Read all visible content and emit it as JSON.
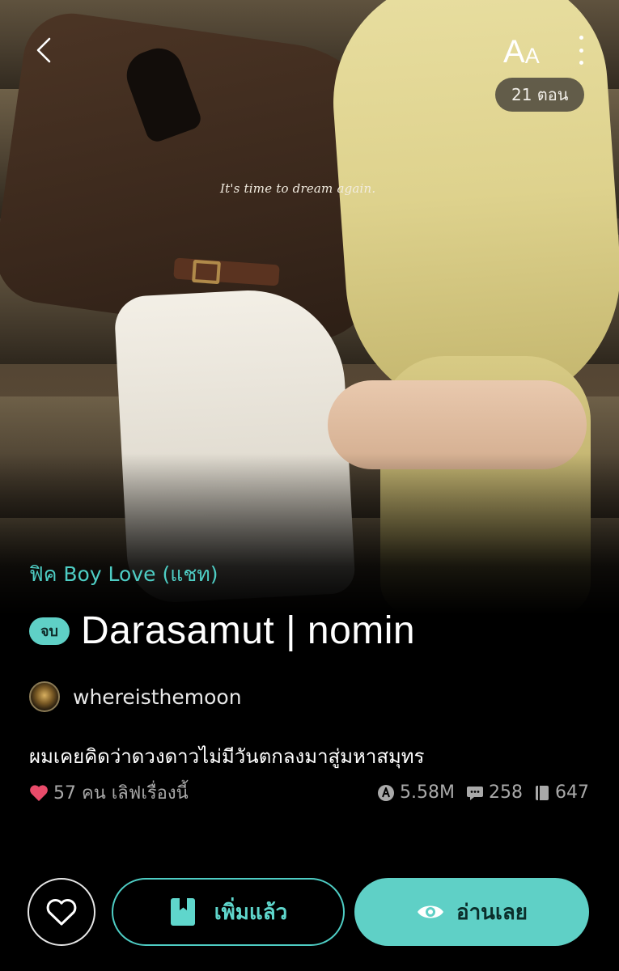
{
  "cover": {
    "tagline": "It's time to dream   again."
  },
  "top_bar": {
    "font_button_big": "A",
    "font_button_small": "A",
    "episode_count": "21 ตอน"
  },
  "story": {
    "category": "ฟิค Boy Love (แชท)",
    "status_badge": "จบ",
    "title": "Darasamut | nomin",
    "author": "whereisthemoon",
    "description": "ผมเคยคิดว่าดวงดาวไม่มีวันตกลงมาสู่มหาสมุทร"
  },
  "stats": {
    "love_text": "57 คน เลิฟเรื่องนี้",
    "views": "5.58M",
    "comments": "258",
    "chapters": "647"
  },
  "actions": {
    "library_label": "เพิ่มแล้ว",
    "read_label": "อ่านเลย"
  },
  "colors": {
    "accent": "#5fd0c6",
    "heart": "#e94b6a",
    "background": "#000000"
  }
}
